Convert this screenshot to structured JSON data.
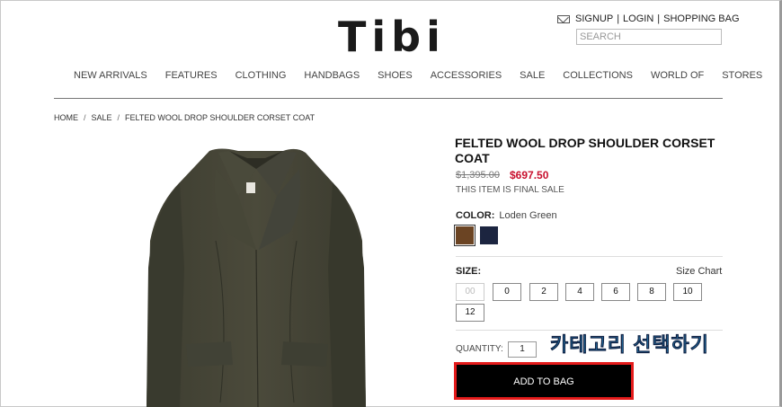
{
  "header": {
    "logo": "Tibi",
    "signup": "SIGNUP",
    "login": "LOGIN",
    "bag": "SHOPPING BAG",
    "search_placeholder": "SEARCH"
  },
  "nav": [
    "NEW ARRIVALS",
    "FEATURES",
    "CLOTHING",
    "HANDBAGS",
    "SHOES",
    "ACCESSORIES",
    "SALE",
    "COLLECTIONS",
    "WORLD OF",
    "STORES"
  ],
  "breadcrumb": [
    "HOME",
    "SALE",
    "FELTED WOOL DROP SHOULDER CORSET COAT"
  ],
  "product": {
    "title": "FELTED WOOL DROP SHOULDER CORSET COAT",
    "old_price": "$1,395.00",
    "new_price": "$697.50",
    "final_sale": "THIS ITEM IS FINAL SALE",
    "color_label": "COLOR:",
    "color_value": "Loden Green",
    "swatch_colors": [
      "#6b4423",
      "#1c2540"
    ],
    "size_label": "SIZE:",
    "size_chart": "Size Chart",
    "sizes": [
      "00",
      "0",
      "2",
      "4",
      "6",
      "8",
      "10",
      "12"
    ],
    "quantity_label": "QUANTITY:",
    "quantity": "1",
    "add_to_bag": "ADD TO BAG"
  },
  "annotation": "카테고리 선택하기"
}
